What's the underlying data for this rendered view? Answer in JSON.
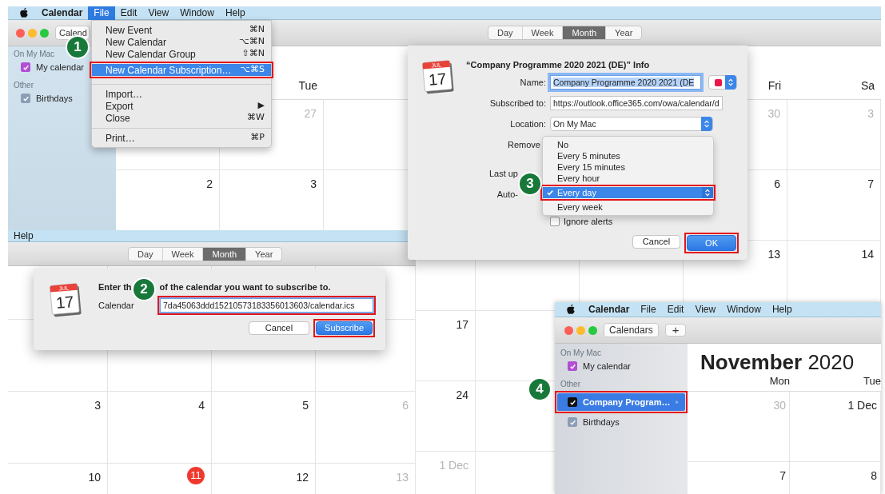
{
  "top_window": {
    "menubar": [
      {
        "label": "Calendar",
        "kind": "app",
        "selected": false
      },
      {
        "label": "File",
        "kind": "menu",
        "selected": true
      },
      {
        "label": "Edit",
        "kind": "menu",
        "selected": false
      },
      {
        "label": "View",
        "kind": "menu",
        "selected": false
      },
      {
        "label": "Window",
        "kind": "menu",
        "selected": false
      },
      {
        "label": "Help",
        "kind": "menu",
        "selected": false
      }
    ],
    "toolbar_button": "Calend",
    "view_tabs": [
      {
        "label": "Day",
        "selected": false
      },
      {
        "label": "Week",
        "selected": false
      },
      {
        "label": "Month",
        "selected": true
      },
      {
        "label": "Year",
        "selected": false
      }
    ],
    "sidebar": [
      {
        "heading": "On My Mac",
        "calendars": [
          {
            "name": "My calendar",
            "checked": true,
            "color": "#b24fd4"
          }
        ]
      },
      {
        "heading": "Other",
        "calendars": [
          {
            "name": "Birthdays",
            "checked": true,
            "color": "#8c9db6"
          }
        ]
      }
    ],
    "calendar": {
      "header_rows": [
        [
          null,
          {
            "label": "Tue"
          },
          null,
          null,
          null,
          {
            "label": "Fri"
          },
          {
            "label": "Sa"
          }
        ]
      ],
      "rows": [
        [
          null,
          {
            "day": "27",
            "muted": true
          },
          null,
          null,
          null,
          {
            "day": "30",
            "muted": true
          },
          {
            "day": "3",
            "muted": true
          }
        ],
        [
          {
            "day": "2",
            "muted": false
          },
          {
            "day": "3",
            "muted": false
          },
          null,
          null,
          null,
          {
            "day": "6",
            "muted": false
          },
          {
            "day": "7",
            "muted": false
          }
        ],
        [
          null,
          null,
          null,
          null,
          null,
          {
            "day": "13",
            "muted": false
          },
          {
            "day": "14",
            "muted": false
          }
        ],
        [
          null,
          null,
          {
            "day": "17",
            "muted": false
          },
          null,
          null,
          null,
          null
        ],
        [
          null,
          null,
          {
            "day": "24",
            "muted": false
          },
          null,
          null,
          null,
          null
        ],
        [
          null,
          null,
          {
            "day": "1 Dec",
            "muted": true
          },
          null,
          null,
          null,
          null
        ]
      ]
    }
  },
  "file_menu": {
    "items": [
      {
        "kind": "item",
        "label": "New Event",
        "shortcut": "⌘N",
        "selected": false
      },
      {
        "kind": "item",
        "label": "New Calendar",
        "shortcut": "⌥⌘N",
        "selected": false
      },
      {
        "kind": "item",
        "label": "New Calendar Group",
        "shortcut": "⇧⌘N",
        "selected": false
      },
      {
        "kind": "item",
        "label": "New Calendar Subscription…",
        "shortcut": "⌥⌘S",
        "selected": true
      },
      {
        "kind": "separator"
      },
      {
        "kind": "item",
        "label": "Import…",
        "selected": false
      },
      {
        "kind": "submenu",
        "label": "Export",
        "shortcut": "▶",
        "selected": false
      },
      {
        "kind": "item",
        "label": "Close",
        "shortcut": "⌘W",
        "selected": false
      },
      {
        "kind": "separator"
      },
      {
        "kind": "item",
        "label": "Print…",
        "shortcut": "⌘P",
        "selected": false
      }
    ]
  },
  "info_dialog": {
    "icon": {
      "month": "JUL",
      "day": "17"
    },
    "title": "“Company Programme 2020 2021 (DE)” Info",
    "fields": [
      {
        "label": "Name:",
        "kind": "text",
        "value": "Company Programme 2020 2021 (DE",
        "focused": true,
        "color": "#e8194a"
      },
      {
        "label": "Subscribed to:",
        "kind": "text",
        "value": "https://outlook.office365.com/owa/calendar/d",
        "focused": false
      },
      {
        "label": "Location:",
        "kind": "select",
        "value": "On My Mac",
        "focused": false
      },
      {
        "label": "Remove",
        "kind": "blank"
      },
      {
        "label": "Last up",
        "kind": "blank"
      },
      {
        "label": "Auto-",
        "kind": "blank"
      }
    ],
    "refresh_menu": [
      {
        "label": "No",
        "selected": false
      },
      {
        "label": "Every 5 minutes",
        "selected": false
      },
      {
        "label": "Every 15 minutes",
        "selected": false
      },
      {
        "label": "Every hour",
        "selected": false
      },
      {
        "label": "Every day",
        "selected": true
      },
      {
        "label": "Every week",
        "selected": false
      }
    ],
    "ignore_alerts": {
      "label": "Ignore alerts",
      "checked": false
    },
    "buttons": [
      {
        "label": "Cancel",
        "default": false
      },
      {
        "label": "OK",
        "default": true
      }
    ]
  },
  "bottom_left_window": {
    "menubar": [
      {
        "label": "Help",
        "kind": "menu",
        "selected": false
      }
    ],
    "view_tabs": [
      {
        "label": "Day",
        "selected": false
      },
      {
        "label": "Week",
        "selected": false
      },
      {
        "label": "Month",
        "selected": true
      },
      {
        "label": "Year",
        "selected": false
      }
    ],
    "calendar": {
      "rows": [
        [
          null,
          null,
          null,
          null
        ],
        [
          null,
          null,
          null,
          null
        ],
        [
          {
            "day": "3",
            "muted": false,
            "today": false
          },
          {
            "day": "4",
            "muted": false,
            "today": false
          },
          {
            "day": "5",
            "muted": false,
            "today": false
          },
          {
            "day": "6",
            "muted": true,
            "today": false
          }
        ],
        [
          {
            "day": "10",
            "muted": false,
            "today": false
          },
          {
            "day": "11",
            "muted": false,
            "today": true
          },
          {
            "day": "12",
            "muted": false,
            "today": false
          },
          {
            "day": "13",
            "muted": true,
            "today": false
          }
        ]
      ]
    }
  },
  "subscribe_dialog": {
    "icon": {
      "month": "JUL",
      "day": "17"
    },
    "prompt_parts": [
      "Enter th",
      "of the calendar you want to subscribe to."
    ],
    "url_label": "Calendar",
    "url": {
      "value": "7da45063ddd15210573183356013603/calendar.ics",
      "focused": true
    },
    "buttons": [
      {
        "label": "Cancel",
        "default": false
      },
      {
        "label": "Subscribe",
        "default": true
      }
    ]
  },
  "bottom_right_window": {
    "menubar": [
      {
        "label": "Calendar",
        "kind": "app",
        "selected": false
      },
      {
        "label": "File",
        "kind": "menu",
        "selected": false
      },
      {
        "label": "Edit",
        "kind": "menu",
        "selected": false
      },
      {
        "label": "View",
        "kind": "menu",
        "selected": false
      },
      {
        "label": "Window",
        "kind": "menu",
        "selected": false
      },
      {
        "label": "Help",
        "kind": "menu",
        "selected": false
      }
    ],
    "toolbar_buttons": [
      "Calendars",
      "+"
    ],
    "sidebar": [
      {
        "heading": "On My Mac",
        "calendars": [
          {
            "name": "My calendar",
            "checked": true,
            "color": "#b24fd4",
            "selected": false,
            "subscribed": false
          }
        ]
      },
      {
        "heading": "Other",
        "calendars": [
          {
            "name": "Company Program…",
            "checked": true,
            "color": "#111111",
            "selected": true,
            "subscribed": true
          },
          {
            "name": "Birthdays",
            "checked": true,
            "color": "#8c9db6",
            "selected": false,
            "subscribed": false
          }
        ]
      }
    ],
    "title": "**November** 2020",
    "calendar": {
      "header_rows": [
        [
          {
            "label": "Mon"
          },
          {
            "label": "Tue"
          }
        ]
      ],
      "rows": [
        [
          {
            "day": "30",
            "muted": true
          },
          {
            "day": "1 Dec",
            "muted": false
          }
        ],
        [
          {
            "day": "7",
            "muted": false
          },
          {
            "day": "8",
            "muted": false
          }
        ]
      ]
    }
  },
  "annotations": [
    {
      "number": "1"
    },
    {
      "number": "2"
    },
    {
      "number": "3"
    },
    {
      "number": "4"
    }
  ]
}
